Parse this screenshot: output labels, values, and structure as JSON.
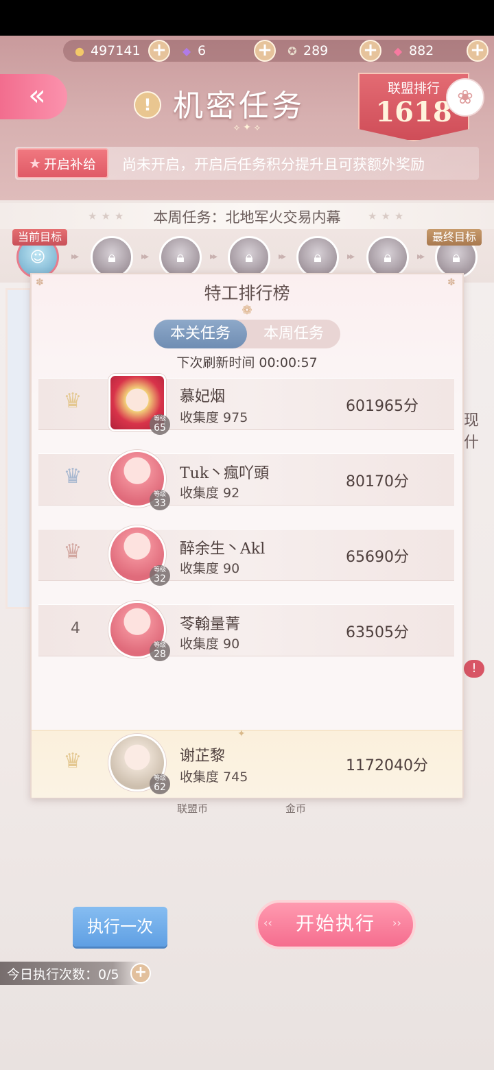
{
  "currencies": [
    {
      "icon": "cat-coin-icon",
      "value": "497141"
    },
    {
      "icon": "diamond-icon",
      "value": "6"
    },
    {
      "icon": "star-coin-icon",
      "value": "289"
    },
    {
      "icon": "pink-diamond-icon",
      "value": "882"
    }
  ],
  "header": {
    "back_label": "«",
    "title": "机密任务",
    "rank_label": "联盟排行",
    "rank_value": "1618"
  },
  "supply": {
    "button_label": "开启补给",
    "message": "尚未开启，开启后任务积分提升且可获额外奖励"
  },
  "weekly": {
    "text": "本周任务：北地军火交易内幕"
  },
  "path": {
    "current_tag": "当前目标",
    "final_tag": "最终目标"
  },
  "leaderboard": {
    "title": "特工排行榜",
    "tabs": [
      "本关任务",
      "本周任务"
    ],
    "active_tab": 0,
    "refresh_text": "下次刷新时间 00:00:57",
    "level_label": "等级",
    "rows": [
      {
        "rank": "1",
        "name": "慕妃烟",
        "collection": "收集度 975",
        "level": "65",
        "score": "601965分"
      },
      {
        "rank": "2",
        "name": "Tuk丶瘋吖頭",
        "collection": "收集度 92",
        "level": "33",
        "score": "80170分"
      },
      {
        "rank": "3",
        "name": "醉余生丶Akl",
        "collection": "收集度 90",
        "level": "32",
        "score": "65690分"
      },
      {
        "rank": "4",
        "name": "苓翰量菁",
        "collection": "收集度 90",
        "level": "28",
        "score": "63505分"
      }
    ],
    "self": {
      "name": "谢芷黎",
      "collection": "收集度 745",
      "level": "62",
      "score": "1172040分"
    }
  },
  "background": {
    "side_text": "现\n什",
    "label_alliance": "联盟币",
    "label_gold": "金币"
  },
  "actions": {
    "execute_once": "执行一次",
    "start_execute": "开始执行",
    "daily_count": "今日执行次数：0/5"
  },
  "colors": {
    "accent_pink": "#f56d8e",
    "rank_red": "#cf4d58",
    "blue_button": "#5f9fe3"
  }
}
